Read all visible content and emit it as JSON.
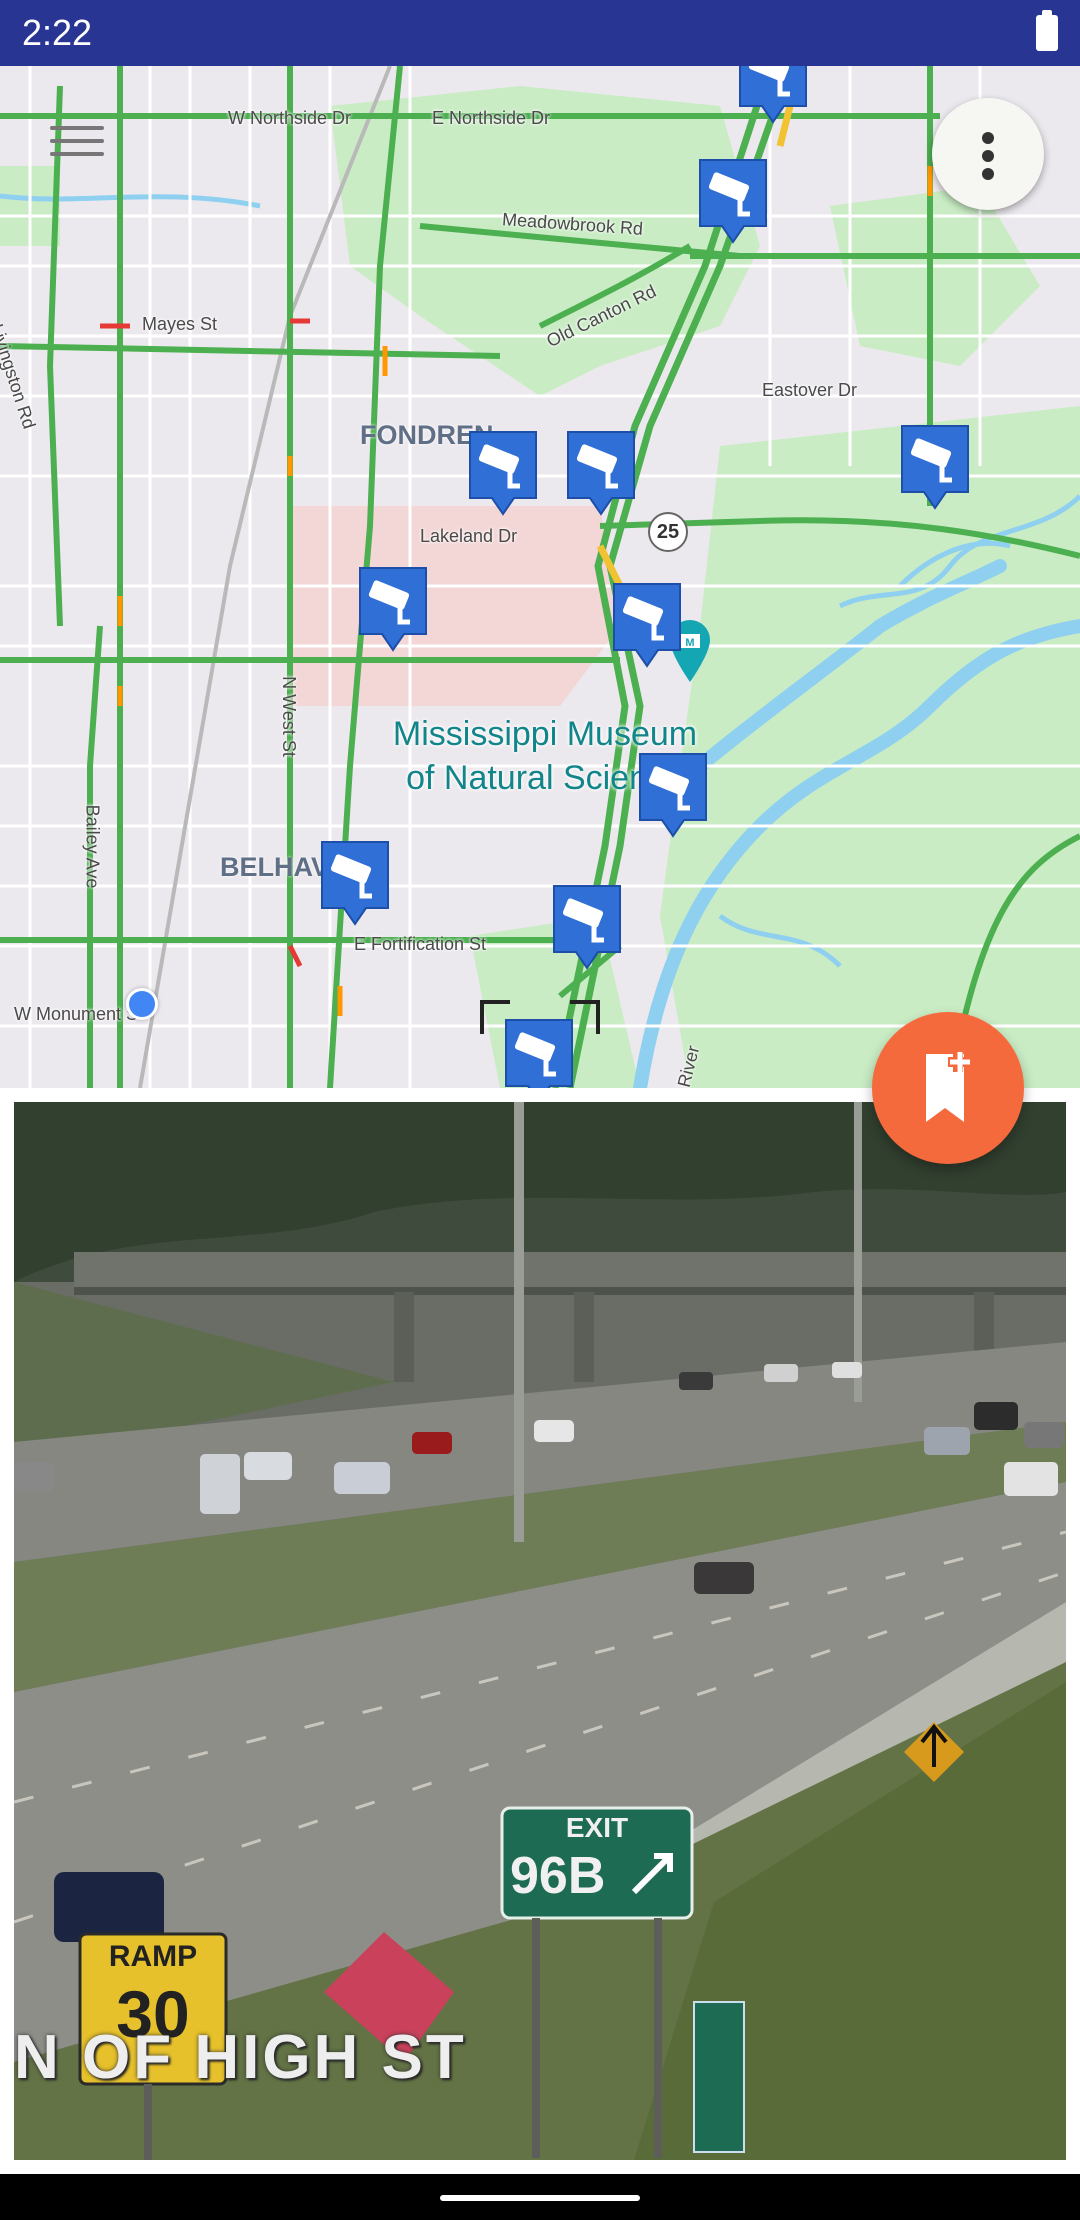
{
  "status_bar": {
    "time": "2:22",
    "battery_icon": "battery-full-icon"
  },
  "map": {
    "colors": {
      "traffic_green": "#4caf50",
      "marker_blue": "#2f6fd6",
      "water": "#8fd0f0",
      "park": "#c9ecc4"
    },
    "road_labels": {
      "w_northside": "W Northside Dr",
      "e_northside": "E Northside Dr",
      "meadowbrook": "Meadowbrook Rd",
      "old_canton": "Old Canton Rd",
      "mayes": "Mayes St",
      "livingston": "Livingston Rd",
      "eastover": "Eastover Dr",
      "lakeland": "Lakeland Dr",
      "n_west": "N West St",
      "bailey": "Bailey Ave",
      "e_fortification": "E Fortification St",
      "w_monument": "W Monument St",
      "river": "River"
    },
    "area_labels": {
      "fondren": "FONDREN",
      "belhaven": "BELHAV"
    },
    "poi": {
      "line1": "Mississippi Museum",
      "line2": "of Natural Science"
    },
    "route_shield": "25",
    "icons": {
      "menu": "menu-icon",
      "overflow": "more-vert-icon",
      "camera": "traffic-camera-icon",
      "museum": "museum-pin-icon",
      "location": "my-location-dot"
    }
  },
  "camera_view": {
    "overlay_caption": "N OF HIGH ST",
    "exit_sign": {
      "top": "EXIT",
      "number": "96B"
    },
    "ramp_sign": {
      "top": "RAMP",
      "speed": "30"
    }
  },
  "fab": {
    "icon": "add-bookmark-icon",
    "color": "#f46a3c"
  }
}
